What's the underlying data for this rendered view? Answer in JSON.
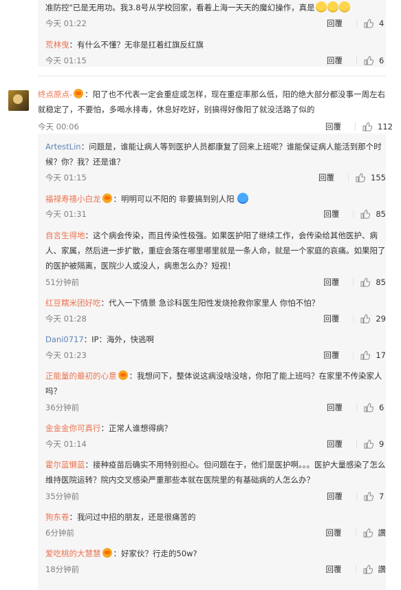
{
  "top_replies": [
    {
      "text_full": "准防控\"已是无用功。我3.8号从学校回家，看着上海一天天的魔幻操作，真是",
      "time": "今天 01:22",
      "reply_label": "回覆",
      "likes": "4"
    },
    {
      "author": "荒林曳",
      "text": "有什么不懂？无非是扛着红旗反红旗",
      "time": "今天 01:15",
      "reply_label": "回覆",
      "likes": "6"
    }
  ],
  "main_comment": {
    "author": "终点原点-",
    "text": "阳了也不代表一定会重症或怎样，现在重症率那么低，阳的绝大部分都没事一周左右就稳定了，不要怕，多喝水排毒，休息好吃好，别搞得好像阳了就没活路了似的",
    "time": "今天 00:06",
    "reply_label": "回覆",
    "likes": "112"
  },
  "replies": [
    {
      "author": "ArtestLin",
      "text": "问题是，谁能让病人等到医护人员都康复了回来上班呢？谁能保证病人能活到那个时候？你？我？还是谁？",
      "time": "今天 01:15",
      "reply_label": "回覆",
      "likes": "155"
    },
    {
      "author": "福禄寿禧小白龙",
      "text": "明明可以不阳的 非要搞到别人阳",
      "time": "今天 01:31",
      "reply_label": "回覆",
      "likes": "85"
    },
    {
      "author": "自言生得地",
      "text": "这个病会传染，而且传染性极强。如果医护阳了继续工作，会传染给其他医护、病人、家属，然后进一步扩散，重症会落在哪里哪里就是一条人命，就是一个家庭的哀痛。如果阳了的医护被隔离，医院少人或没人，病患怎么办？短视！",
      "time": "51分钟前",
      "reply_label": "回覆",
      "likes": "85"
    },
    {
      "author": "红豆糯米团好吃",
      "text": "代入一下情景 急诊科医生阳性发烧抢救你家里人 你怕不怕？",
      "time": "今天 01:28",
      "reply_label": "回覆",
      "likes": "29"
    },
    {
      "author": "Dani0717",
      "text": "IP：海外，快逃啊",
      "time": "今天 01:23",
      "reply_label": "回覆",
      "likes": "17"
    },
    {
      "author": "正能量的最初的心意",
      "text": "我想问下，整体说这病没啥没啥，你阳了能上班吗？在家里不传染家人吗？",
      "time": "36分钟前",
      "reply_label": "回覆",
      "likes": "6"
    },
    {
      "author": "金金金你可真行",
      "text": "正常人谁想得病？",
      "time": "今天 01:14",
      "reply_label": "回覆",
      "likes": "9"
    },
    {
      "author": "霍尔蓝懒蓝",
      "text": "接种疫苗后确实不用特别担心。但问题在于，他们是医护啊。。。医护大量感染了怎么维持医院运转？院内交叉感染严重那些本就在医院里的有基础病的人怎么办？",
      "time": "35分钟前",
      "reply_label": "回覆",
      "likes": "7"
    },
    {
      "author": "狗东卷",
      "text": "我问过中招的朋友，还是很痛苦的",
      "time": "6分钟前",
      "reply_label": "回覆",
      "likes": "讚"
    },
    {
      "author": "爱吃桃的大慧慧",
      "text": "好家伙？行走的50w?",
      "time": "18分钟前",
      "reply_label": "回覆",
      "likes": "讚"
    }
  ],
  "colors": {
    "author": "#eb7350",
    "author_blue": "#5d83b8",
    "bg_reply": "#f6f6f6"
  },
  "icons": {
    "like": "thumbs-up-icon",
    "badge": "vip-badge-icon",
    "emoji": "emoji-face-icon"
  }
}
